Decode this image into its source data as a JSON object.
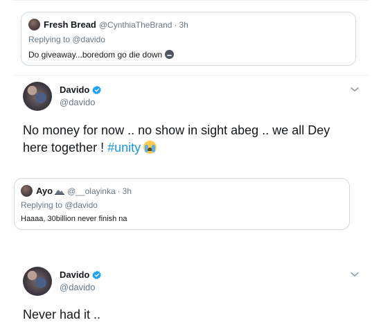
{
  "quote1": {
    "name": "Fresh Bread",
    "handle": "@CynthiaTheBrand",
    "time": "3h",
    "replying": "Replying to @davido",
    "text": "Do giveaway...boredom go die down",
    "emoji": "dizzy-face-emoji"
  },
  "tweet1": {
    "name": "Davido",
    "handle": "@davido",
    "line1": "No money for now .. no show in sight abeg .. we all Dey",
    "line2_prefix": "here together ! ",
    "hashtag": "#unity",
    "emoji": "loudly-crying-emoji",
    "verified_color": "#1da1f2"
  },
  "quote2": {
    "name": "Ayo",
    "handle": "@__olayinka",
    "time": "3h",
    "replying": "Replying to @davido",
    "text": "Haaaa, 30billion never finish na",
    "emoji": "mountain-emoji"
  },
  "tweet2": {
    "name": "Davido",
    "handle": "@davido",
    "text": "Never had it .."
  },
  "colors": {
    "link": "#1b95e0",
    "secondary_text": "#657786",
    "border": "#cfd9de"
  },
  "separator": "·"
}
